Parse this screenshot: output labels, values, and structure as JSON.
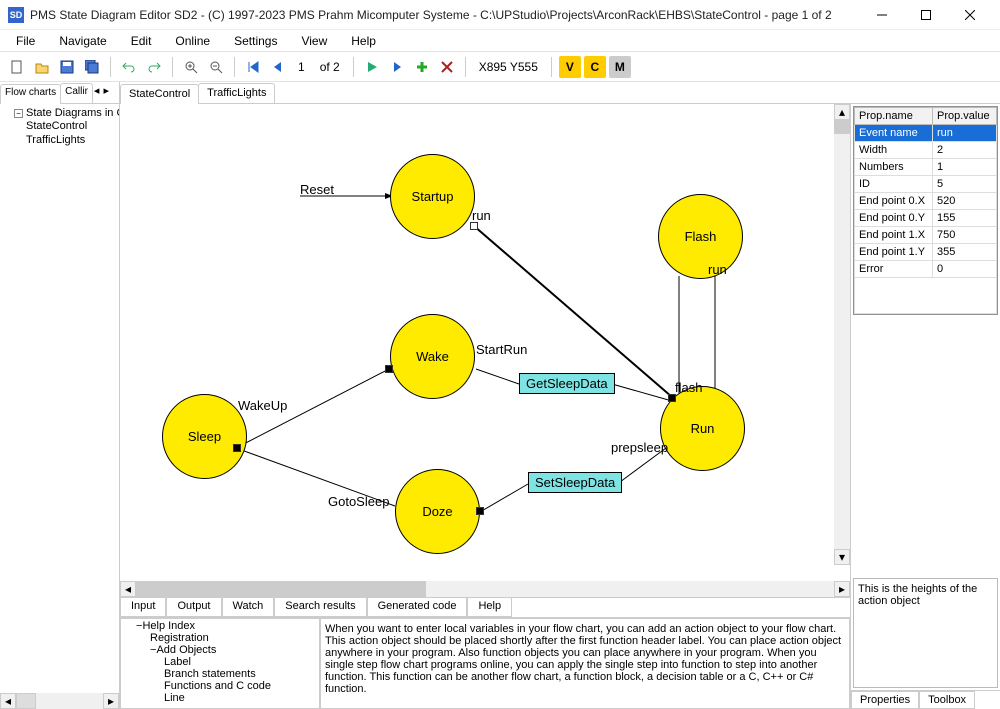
{
  "title": "PMS State Diagram Editor SD2 - (C) 1997-2023 PMS Prahm Micomputer Systeme - C:\\UPStudio\\Projects\\ArconRack\\EHBS\\StateControl - page 1 of 2",
  "menu": [
    "File",
    "Navigate",
    "Edit",
    "Online",
    "Settings",
    "View",
    "Help"
  ],
  "toolbar": {
    "page_current": "1",
    "page_total": "of 2",
    "coords": "X895 Y555",
    "v_label": "V",
    "c_label": "C",
    "m_label": "M"
  },
  "secondrow": {
    "flowcharts": "Flow charts",
    "callir": "Callir",
    "tab_state": "StateControl",
    "tab_traffic": "TrafficLights"
  },
  "tree": {
    "root": "State Diagrams in C",
    "children": [
      "StateControl",
      "TrafficLights"
    ]
  },
  "diagram": {
    "states": {
      "startup": "Startup",
      "flash": "Flash",
      "wake": "Wake",
      "sleep": "Sleep",
      "run": "Run",
      "doze": "Doze"
    },
    "actions": {
      "getsleep": "GetSleepData",
      "setsleep": "SetSleepData"
    },
    "labels": {
      "reset": "Reset",
      "run": "run",
      "run2": "run",
      "startrun": "StartRun",
      "wakeup": "WakeUp",
      "flash": "flash",
      "prepsleep": "prepsleep",
      "gotosleep": "GotoSleep"
    }
  },
  "propgrid": {
    "header_name": "Prop.name",
    "header_value": "Prop.value",
    "rows": [
      {
        "name": "Event name",
        "value": "run"
      },
      {
        "name": "Width",
        "value": "2"
      },
      {
        "name": "Numbers",
        "value": "1"
      },
      {
        "name": "ID",
        "value": "5"
      },
      {
        "name": "End point 0.X",
        "value": "520"
      },
      {
        "name": "End point 0.Y",
        "value": "155"
      },
      {
        "name": "End point 1.X",
        "value": "750"
      },
      {
        "name": "End point 1.Y",
        "value": "355"
      },
      {
        "name": "Error",
        "value": "0"
      }
    ]
  },
  "helphint": "This is the heights of the action object",
  "righttabs": {
    "properties": "Properties",
    "toolbox": "Toolbox"
  },
  "bottomtabs": [
    "Input",
    "Output",
    "Watch",
    "Search results",
    "Generated code",
    "Help"
  ],
  "helptree": {
    "root": "Help Index",
    "items": [
      "Registration"
    ],
    "addobjects": "Add Objects",
    "sub": [
      "Label",
      "Branch statements",
      "Functions and C code",
      "Line"
    ]
  },
  "helptext": "When you want to enter local variables in your flow chart, you can add an action object to your flow chart. This action object should be placed shortly after the first function header label. You can place action object anywhere in your program. Also function objects you can place anywhere in your program. When you single step flow chart programs online, you can apply the single step into function to step into another function. This function can be another flow chart, a function block, a decision table or a C, C++ or C# function."
}
